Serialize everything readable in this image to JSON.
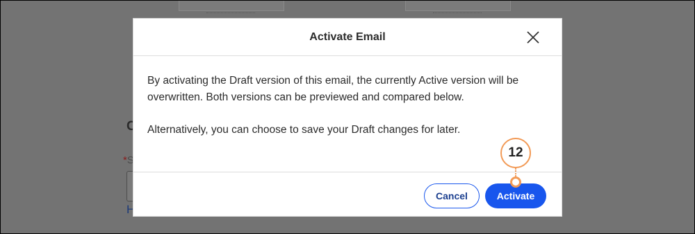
{
  "background": {
    "letter_c": "C",
    "required_asterisk": "*",
    "field_label_initial": "S",
    "link_initial": "H"
  },
  "modal": {
    "title": "Activate Email",
    "close_icon": "close-icon",
    "body": {
      "paragraph_1": "By activating the Draft version of this email, the currently Active version will be overwritten. Both versions can be previewed and compared below.",
      "paragraph_2": "Alternatively, you can choose to save your Draft changes for later."
    },
    "footer": {
      "cancel_label": "Cancel",
      "activate_label": "Activate"
    }
  },
  "callout": {
    "step_number": "12"
  },
  "colors": {
    "overlay": "#737373",
    "primary": "#1856ed",
    "callout": "#f29a56"
  }
}
